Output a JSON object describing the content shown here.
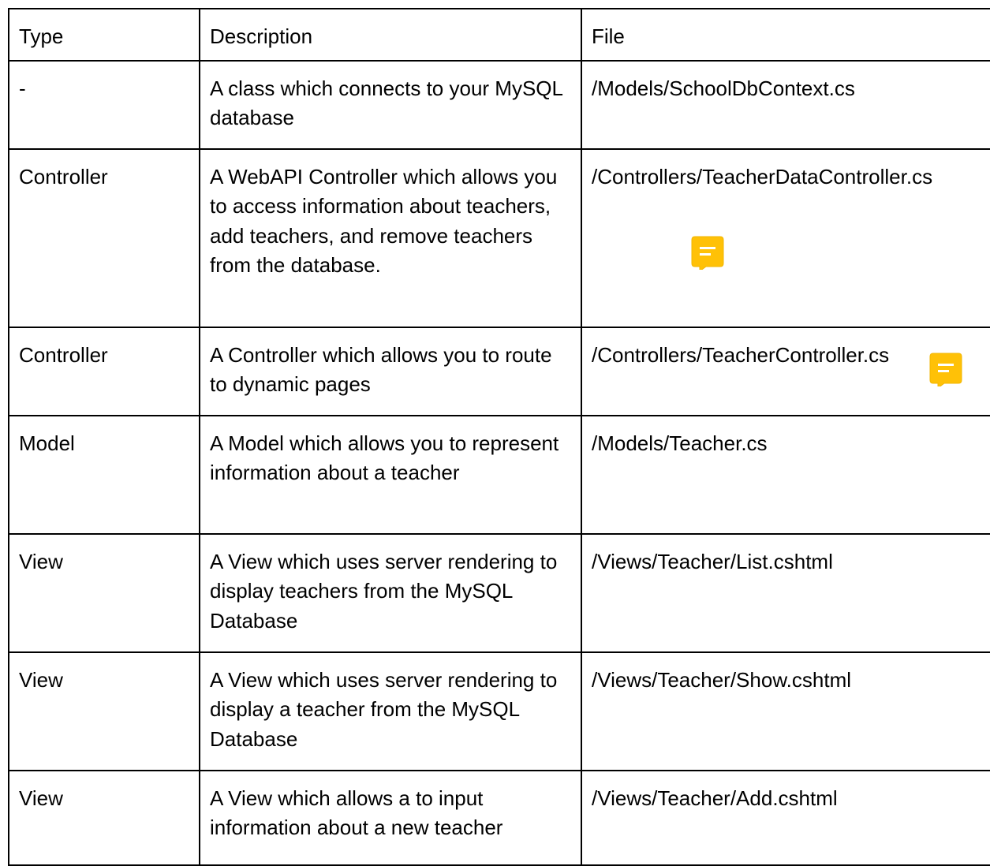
{
  "table": {
    "headers": [
      "Type",
      "Description",
      "File"
    ],
    "rows": [
      {
        "type": "-",
        "description": "A class which connects to your MySQL database",
        "file": "/Models/SchoolDbContext.cs"
      },
      {
        "type": "Controller",
        "description": "A WebAPI Controller which allows you to access information about teachers, add teachers, and remove teachers from the database.",
        "file": "/Controllers/TeacherDataController.cs"
      },
      {
        "type": "Controller",
        "description": "A Controller which allows you to route to dynamic pages",
        "file": "/Controllers/TeacherController.cs"
      },
      {
        "type": "Model",
        "description": "A Model which allows you to represent information about a teacher",
        "file": "/Models/Teacher.cs"
      },
      {
        "type": "View",
        "description": "A View which uses server rendering to display teachers from the MySQL Database",
        "file": "/Views/Teacher/List.cshtml"
      },
      {
        "type": "View",
        "description": "A View which uses server rendering to display a teacher from the MySQL Database",
        "file": "/Views/Teacher/Show.cshtml"
      },
      {
        "type": "View",
        "description": "A View which allows a to input information about a new teacher",
        "file": "/Views/Teacher/Add.cshtml"
      }
    ]
  },
  "comment_icon": {
    "icon": "comment-icon",
    "color": "#FFC107"
  }
}
